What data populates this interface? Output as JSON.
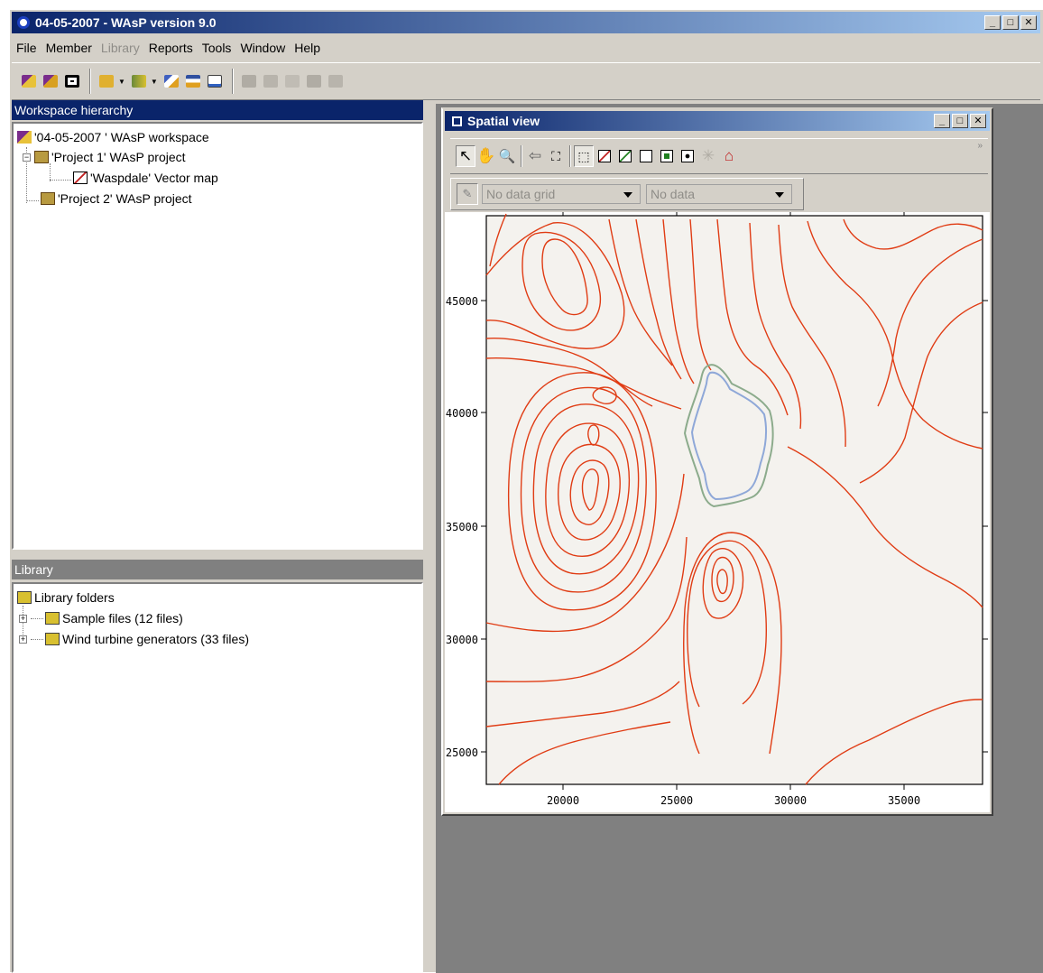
{
  "window": {
    "title": "04-05-2007  - WAsP version 9.0"
  },
  "menu": [
    {
      "label": "File",
      "enabled": true
    },
    {
      "label": "Member",
      "enabled": true
    },
    {
      "label": "Library",
      "enabled": false
    },
    {
      "label": "Reports",
      "enabled": true
    },
    {
      "label": "Tools",
      "enabled": true
    },
    {
      "label": "Window",
      "enabled": true
    },
    {
      "label": "Help",
      "enabled": true
    }
  ],
  "workspace": {
    "title": "Workspace hierarchy",
    "root": "'04-05-2007 ' WAsP workspace",
    "project1": "'Project 1' WAsP project",
    "vectormap": "'Waspdale' Vector map",
    "project2": "'Project 2' WAsP project"
  },
  "library": {
    "title": "Library",
    "root": "Library folders",
    "folder1": "Sample files (12 files)",
    "folder2": "Wind turbine generators (33 files)"
  },
  "spatial": {
    "title": "Spatial view",
    "grid_combo": "No data grid",
    "data_combo": "No data",
    "x_ticks": [
      "20000",
      "25000",
      "30000",
      "35000"
    ],
    "y_ticks": [
      "45000",
      "40000",
      "35000",
      "30000",
      "25000"
    ]
  },
  "colors": {
    "contour": "#e03c14",
    "lake": "#8fa8d8",
    "lake_edge": "#8cab8c"
  }
}
